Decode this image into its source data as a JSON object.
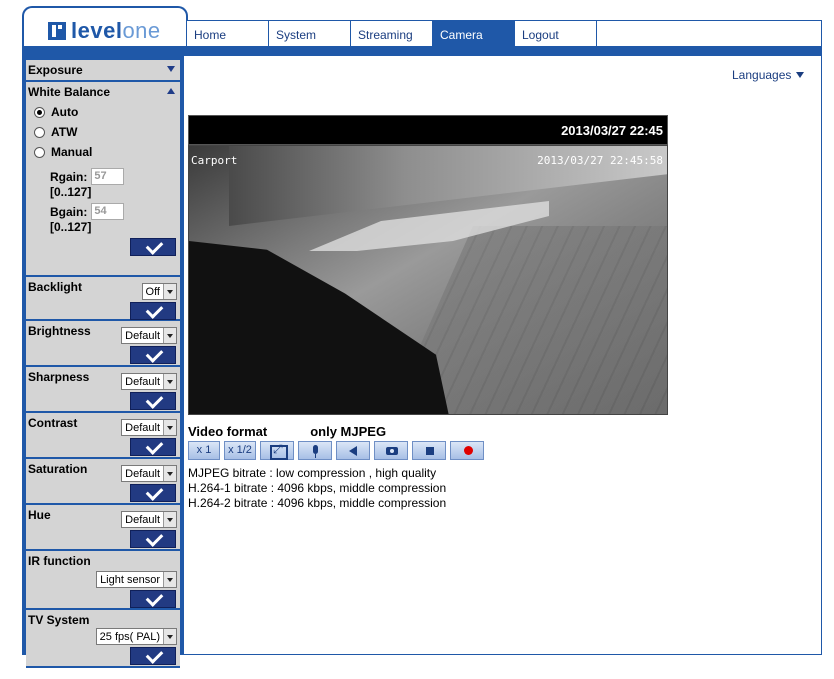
{
  "brand": {
    "logo_bold": "level",
    "logo_light": "one"
  },
  "nav": {
    "items": [
      "Home",
      "System",
      "Streaming",
      "Camera",
      "Logout"
    ],
    "active": "Camera"
  },
  "languages": {
    "label": "Languages"
  },
  "sidebar": {
    "exposure": {
      "title": "Exposure"
    },
    "white_balance": {
      "title": "White Balance",
      "options": [
        "Auto",
        "ATW",
        "Manual"
      ],
      "selected": "Auto",
      "rgain_label": "Rgain:",
      "rgain_value": "57",
      "rgain_range": "[0..127]",
      "bgain_label": "Bgain:",
      "bgain_value": "54",
      "bgain_range": "[0..127]"
    },
    "backlight": {
      "title": "Backlight",
      "value": "Off"
    },
    "brightness": {
      "title": "Brightness",
      "value": "Default"
    },
    "sharpness": {
      "title": "Sharpness",
      "value": "Default"
    },
    "contrast": {
      "title": "Contrast",
      "value": "Default"
    },
    "saturation": {
      "title": "Saturation",
      "value": "Default"
    },
    "hue": {
      "title": "Hue",
      "value": "Default"
    },
    "ir_function": {
      "title": "IR function",
      "value": "Light sensor"
    },
    "tv_system": {
      "title": "TV System",
      "value": "25 fps( PAL)"
    }
  },
  "video": {
    "bar_timestamp": "2013/03/27 22:45",
    "osd_title": "Carport",
    "osd_timestamp": "2013/03/27 22:45:58"
  },
  "video_format": {
    "label": "Video format",
    "value": "only MJPEG"
  },
  "controls": {
    "zoom1": "x 1",
    "zoom_half": "x 1/2"
  },
  "bitrates": [
    "MJPEG bitrate : low compression , high quality",
    "H.264-1 bitrate : 4096 kbps, middle compression",
    "H.264-2 bitrate : 4096 kbps, middle compression"
  ]
}
